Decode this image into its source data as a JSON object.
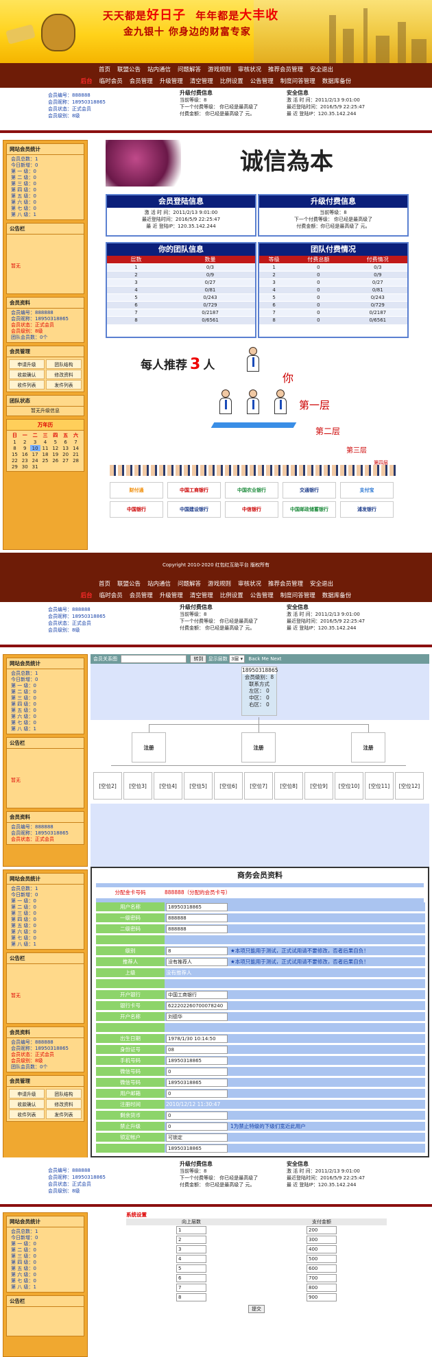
{
  "banner": {
    "slogan1a": "天天都是",
    "slogan1b": "好日子",
    "slogan1c": "年年都是",
    "slogan1d": "大丰收",
    "slogan2": "金九银十  你身边的财富专家"
  },
  "nav": {
    "row1": [
      "首页",
      "联盟公告",
      "站内通信",
      "问题解答",
      "游戏规则",
      "审核状况",
      "推荐会员管理",
      "安全退出"
    ],
    "row2": [
      "后台",
      "临时会员",
      "会员管理",
      "升级管理",
      "清空管理",
      "比例设置",
      "公告管理",
      "制度问答管理",
      "数据库备份"
    ]
  },
  "info": {
    "user": [
      "会员编号：888888",
      "会员昵称：18950318865",
      "会员状态：正式会员",
      "会员级别：8级"
    ],
    "upgrade_title": "升级付费信息",
    "upgrade": [
      "当前等级：8",
      "下一个付费等级：  你已经是最高级了",
      "付费金额：  你已经是最高级了  元。"
    ],
    "safe_title": "安全信息",
    "safe": [
      "激 活 时 间：2011/2/13 9:01:00",
      "最近登陆时间：2016/5/9 22:25:47",
      "最 近 登陆IP：120.35.142.244"
    ]
  },
  "side": {
    "stats_title": "网站会员统计",
    "stats": [
      "会员总数：1",
      "今日新增：0",
      "第 一 级：0",
      "第 二 级：0",
      "第 三 级：0",
      "第 四 级：0",
      "第 五 级：0",
      "第 六 级：0",
      "第 七 级：0",
      "第 八 级：1"
    ],
    "notice_title": "公告栏",
    "notice_text": "暂无",
    "member_title": "会员资料",
    "member": [
      "会员编号：888888",
      "会员昵称：18950318865",
      "会员状态：正式会员",
      "会员级别：8级",
      "团队会员数：0个"
    ],
    "manage_title": "会员管理",
    "manage": [
      "申请升级",
      "团队结构",
      "收款确认",
      "修改资料",
      "收件列表",
      "发件列表"
    ],
    "team_title": "团队状态",
    "team_text": "暂无升级信息",
    "cal_title": "万年历",
    "cal_head": [
      "日",
      "一",
      "二",
      "三",
      "四",
      "五",
      "六"
    ],
    "cal_rows": [
      [
        "1",
        "2",
        "3",
        "4",
        "5",
        "6",
        "7"
      ],
      [
        "8",
        "9",
        "10",
        "11",
        "12",
        "13",
        "14"
      ],
      [
        "15",
        "16",
        "17",
        "18",
        "19",
        "20",
        "21"
      ],
      [
        "22",
        "23",
        "24",
        "25",
        "26",
        "27",
        "28"
      ],
      [
        "29",
        "30",
        "31",
        "",
        "",
        "",
        ""
      ]
    ]
  },
  "main1": {
    "login_title": "会员登陆信息",
    "upgrade_title": "升级付费信息",
    "login": [
      "激 活 时 间：2011/2/13 9:01:00",
      "最近登陆时间：2016/5/9 22:25:47",
      "最 近 登陆IP：120.35.142.244"
    ],
    "upgrade": [
      "当前等级：8",
      "下一个付费等级：  你已经是最高级了",
      "付费金额：你已经是最高级了  元。"
    ],
    "team_title": "你的团队信息",
    "pay_title": "团队付费情况",
    "team_head": [
      "层数",
      "数量"
    ],
    "team_rows": [
      [
        "1",
        "0/3"
      ],
      [
        "2",
        "0/9"
      ],
      [
        "3",
        "0/27"
      ],
      [
        "4",
        "0/81"
      ],
      [
        "5",
        "0/243"
      ],
      [
        "6",
        "0/729"
      ],
      [
        "7",
        "0/2187"
      ],
      [
        "8",
        "0/6561"
      ]
    ],
    "pay_head": [
      "等级",
      "付费总额",
      "付费情况"
    ],
    "pay_rows": [
      [
        "1",
        "0",
        "0/3"
      ],
      [
        "2",
        "0",
        "0/9"
      ],
      [
        "3",
        "0",
        "0/27"
      ],
      [
        "4",
        "0",
        "0/81"
      ],
      [
        "5",
        "0",
        "0/243"
      ],
      [
        "6",
        "0",
        "0/729"
      ],
      [
        "7",
        "0",
        "0/2187"
      ],
      [
        "8",
        "0",
        "0/6561"
      ]
    ],
    "promo_a": "每人推荐",
    "promo_num": "3",
    "promo_b": "人",
    "promo_you": "你",
    "promo_l1": "第一层",
    "promo_l2": "第二层",
    "promo_l3": "第三层",
    "promo_l4": "第四层",
    "banks": [
      "财付通",
      "中国工商银行",
      "中国农业银行",
      "交通银行",
      "支付宝",
      "中国银行",
      "中国建设银行",
      "中信银行",
      "中国邮政储蓄银行",
      "浦发银行"
    ]
  },
  "footer": "Copyright 2010-2020 红包红互助平台 版权所有",
  "tree": {
    "search_label": "会员关系图",
    "jump_label": "转到",
    "layers_label": "显示层数",
    "layers_val": "3层",
    "back": "Back",
    "me": "Me",
    "next": "Next",
    "root_id": "18950318865",
    "root_label": "会员级别：8",
    "root_contact": "联系方式",
    "root_zones": [
      "左区：  0",
      "中区：  0",
      "右区：  0"
    ],
    "lvl1": [
      "注册",
      "注册",
      "注册"
    ],
    "lvl2": [
      "[空位2]",
      "[空位3]",
      "[空位4]",
      "[空位5]",
      "[空位6]",
      "[空位7]",
      "[空位8]",
      "[空位9]",
      "[空位10]",
      "[空位11]",
      "[空位12]"
    ]
  },
  "side2": {
    "member": [
      "会员编号：888888",
      "会员昵称：18950318865",
      "会员状态：正式会员"
    ]
  },
  "form": {
    "title": "商务会员资料",
    "cardno_label": "分配金卡号码",
    "cardno_val": "888888（分配的会员卡号）",
    "rows": [
      {
        "l": "用户名称",
        "v": "18950318865"
      },
      {
        "l": "一级密码",
        "v": "888888"
      },
      {
        "l": "二级密码",
        "v": "888888"
      },
      {
        "l": "",
        "v": ""
      },
      {
        "l": "级别",
        "v": "8",
        "n": "★本项只能用于测试，正式试用请不要修改，否者后果自负！"
      },
      {
        "l": "推荐人",
        "v": "没有推荐人",
        "n": "★本项只能用于测试，正式试用请不要修改，否者后果自负！"
      },
      {
        "l": "上级",
        "v": "没有推荐人"
      },
      {
        "l": "",
        "v": ""
      },
      {
        "l": "开户银行",
        "v": "中国工商银行"
      },
      {
        "l": "银行卡号",
        "v": "6222022607000782​40"
      },
      {
        "l": "开户名称",
        "v": "刘德华"
      },
      {
        "l": "",
        "v": ""
      },
      {
        "l": "出生日期",
        "v": "1978/1/30 10:14:50"
      },
      {
        "l": "身份证号",
        "v": "08"
      },
      {
        "l": "手机号码",
        "v": "18950318865"
      },
      {
        "l": "微信号码",
        "v": "0"
      },
      {
        "l": "微信号码",
        "v": "18950318865"
      },
      {
        "l": "用户邮箱",
        "v": "0"
      },
      {
        "l": "注册时间",
        "v": "2010/12/12 11:30:47"
      },
      {
        "l": "剩余货币",
        "v": "0"
      },
      {
        "l": "禁止升级",
        "v": "0",
        "n": "1为禁止特级的下级们宽近此用户"
      },
      {
        "l": "锁定帐户",
        "v": "可锁定"
      },
      {
        "l": "",
        "v": "18950318865"
      }
    ]
  },
  "settings": {
    "title": "系统设置",
    "head": [
      "向上层数",
      "支付金额"
    ],
    "rows": [
      [
        "1",
        "200"
      ],
      [
        "2",
        "300"
      ],
      [
        "3",
        "400"
      ],
      [
        "4",
        "500"
      ],
      [
        "5",
        "600"
      ],
      [
        "6",
        "700"
      ],
      [
        "7",
        "800"
      ],
      [
        "8",
        "900"
      ]
    ],
    "submit": "提交"
  }
}
